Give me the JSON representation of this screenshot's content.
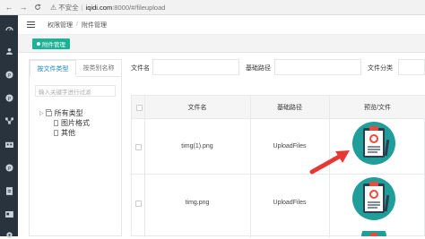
{
  "browser": {
    "back_icon": "←",
    "forward_icon": "→",
    "reload_icon": "C",
    "security_label": "不安全",
    "url_host": "iqidi.com",
    "url_path": ":8000/#/fileupload"
  },
  "header": {
    "breadcrumb": [
      "权限管理",
      "附件管理"
    ],
    "separator": "/"
  },
  "tags": {
    "active_label": "附件管理"
  },
  "left_panel": {
    "tabs": [
      "按文件类型",
      "按类别名称"
    ],
    "active_tab": 0,
    "search_placeholder": "输入关键字进行过滤",
    "tree": {
      "root": "所有类型",
      "children": [
        "图片格式",
        "其他"
      ]
    }
  },
  "filters": {
    "file_name_label": "文件名",
    "base_path_label": "基础路径",
    "file_category_label": "文件分类"
  },
  "table": {
    "columns": [
      "文件名",
      "基础路径",
      "预览/文件"
    ],
    "rows": [
      {
        "file_name": "timg(1).png",
        "base_path": "UploadFiles"
      },
      {
        "file_name": "timg.png",
        "base_path": "UploadFiles"
      }
    ]
  },
  "colors": {
    "sidebar_bg": "#28333e",
    "accent_green": "#1ab394",
    "accent_blue": "#1c84c6",
    "arrow_red": "#e53935",
    "thumb_teal": "#1f9e9a"
  }
}
